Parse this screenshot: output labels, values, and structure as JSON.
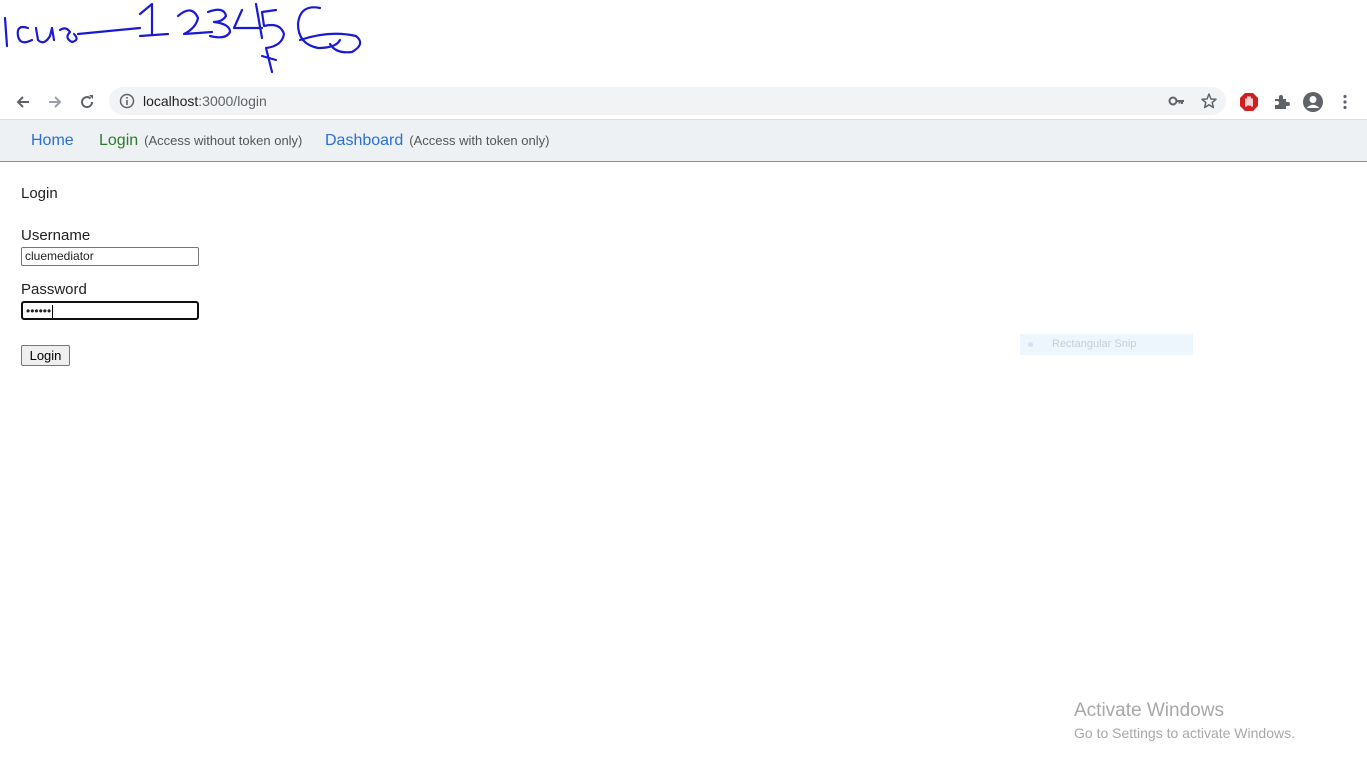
{
  "annotation": {
    "text": "lcus-123456"
  },
  "browser": {
    "url_host": "localhost",
    "url_rest": ":3000/login"
  },
  "nav": {
    "home": "Home",
    "login": "Login",
    "login_note": "(Access without token only)",
    "dashboard": "Dashboard",
    "dashboard_note": "(Access with token only)"
  },
  "form": {
    "heading": "Login",
    "username_label": "Username",
    "username_value": "cluemediator",
    "password_label": "Password",
    "password_value": "••••••",
    "submit_label": "Login"
  },
  "snip": {
    "label": "Rectangular Snip"
  },
  "watermark": {
    "title": "Activate Windows",
    "subtitle": "Go to Settings to activate Windows."
  },
  "colors": {
    "nav_link": "#2a6fd6",
    "nav_active": "#2c7a2c",
    "annotation_ink": "#1a1ad4",
    "extension_red": "#d11f1f"
  }
}
